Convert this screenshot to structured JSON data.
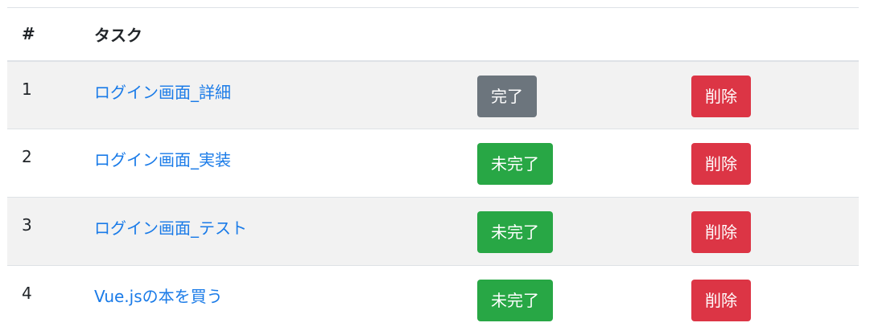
{
  "table": {
    "headers": {
      "number": "#",
      "task": "タスク"
    },
    "rows": [
      {
        "number": "1",
        "task": "ログイン画面_詳細",
        "status_label": "完了",
        "delete_label": "削除"
      },
      {
        "number": "2",
        "task": "ログイン画面_実装",
        "status_label": "未完了",
        "delete_label": "削除"
      },
      {
        "number": "3",
        "task": "ログイン画面_テスト",
        "status_label": "未完了",
        "delete_label": "削除"
      },
      {
        "number": "4",
        "task": "Vue.jsの本を買う",
        "status_label": "未完了",
        "delete_label": "削除"
      }
    ]
  },
  "colors": {
    "link": "#1a7be8",
    "complete_button": "#6c757d",
    "incomplete_button": "#28a745",
    "delete_button": "#dc3545",
    "stripe": "#f2f2f2"
  }
}
